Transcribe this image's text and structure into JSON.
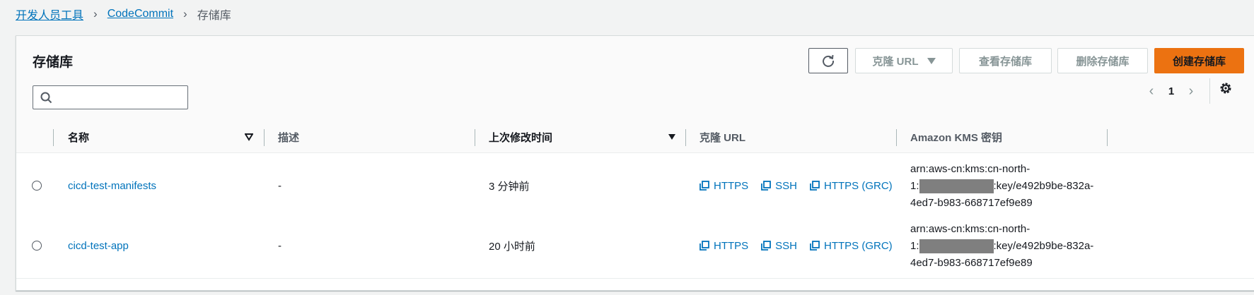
{
  "breadcrumb": {
    "item1": "开发人员工具",
    "item2": "CodeCommit",
    "current": "存储库"
  },
  "panel": {
    "title": "存储库",
    "search": {
      "value": "",
      "placeholder": ""
    },
    "buttons": {
      "clone": "克隆 URL",
      "view": "查看存储库",
      "delete": "删除存储库",
      "create": "创建存储库"
    },
    "pagination": {
      "page": "1"
    }
  },
  "table": {
    "columns": {
      "name": "名称",
      "description": "描述",
      "modified": "上次修改时间",
      "clone": "克隆 URL",
      "kms": "Amazon KMS 密钥"
    },
    "rows": [
      {
        "name": "cicd-test-manifests",
        "description": "-",
        "modified": "3 分钟前",
        "https": "HTTPS",
        "ssh": "SSH",
        "grc": "HTTPS (GRC)",
        "kms_line1": "arn:aws-cn:kms:cn-north-",
        "kms_line2_prefix": "1:",
        "kms_line2_suffix": ":key/e492b9be-832a-",
        "kms_line3": "4ed7-b983-668717ef9e89"
      },
      {
        "name": "cicd-test-app",
        "description": "-",
        "modified": "20 小时前",
        "https": "HTTPS",
        "ssh": "SSH",
        "grc": "HTTPS (GRC)",
        "kms_line1": "arn:aws-cn:kms:cn-north-",
        "kms_line2_prefix": "1:",
        "kms_line2_suffix": ":key/e492b9be-832a-",
        "kms_line3": "4ed7-b983-668717ef9e89"
      }
    ]
  },
  "colors": {
    "link": "#0073bb",
    "primary": "#ec7211",
    "disabled": "#879596"
  }
}
